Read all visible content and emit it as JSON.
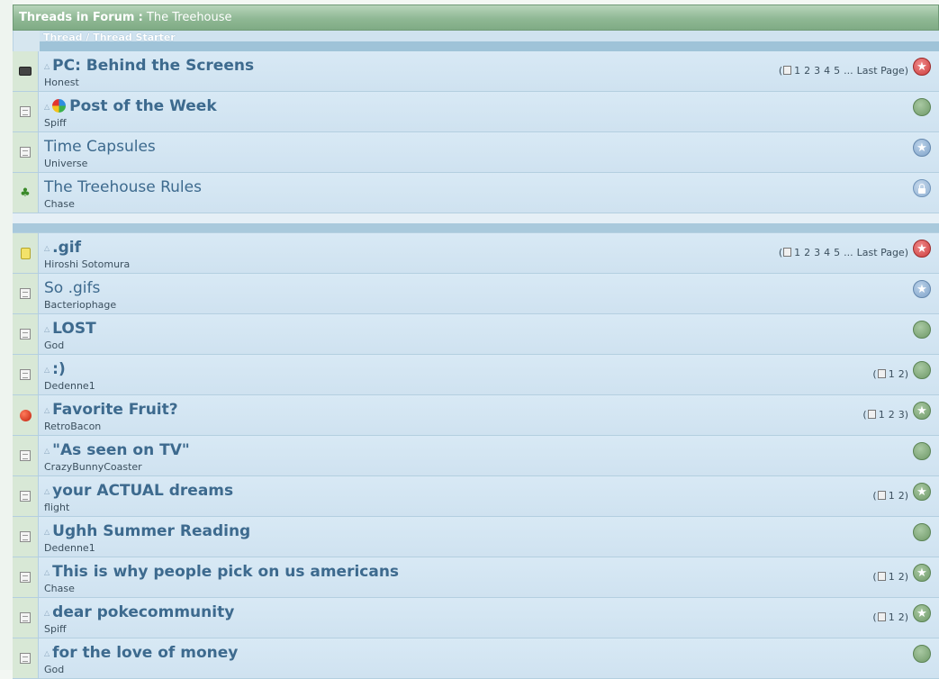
{
  "forum": {
    "header_label": "Threads in Forum",
    "header_sep": ":",
    "forum_name": "The Treehouse",
    "column_header": "Thread / Thread Starter"
  },
  "sticky_threads": [
    {
      "title": "PC: Behind the Screens",
      "starter": "Honest",
      "bold": true,
      "caret": true,
      "prefix_icon": "",
      "row_icon": "camera-icon",
      "pages": [
        "1",
        "2",
        "3",
        "4",
        "5",
        "...",
        "Last Page"
      ],
      "status": "hot-star-icon"
    },
    {
      "title": "Post of the Week",
      "starter": "Spiff",
      "bold": true,
      "caret": true,
      "prefix_icon": "pie-chart-icon",
      "row_icon": "document-icon",
      "pages": [],
      "status": "green-dot-icon"
    },
    {
      "title": "Time Capsules",
      "starter": "Universe",
      "bold": false,
      "caret": false,
      "prefix_icon": "",
      "row_icon": "document-icon",
      "pages": [],
      "status": "blue-star-icon"
    },
    {
      "title": "The Treehouse Rules",
      "starter": "Chase",
      "bold": false,
      "caret": false,
      "prefix_icon": "",
      "row_icon": "tree-icon",
      "pages": [],
      "status": "lock-icon"
    }
  ],
  "threads": [
    {
      "title": ".gif",
      "starter": "Hiroshi Sotomura",
      "bold": true,
      "caret": true,
      "row_icon": "jar-icon",
      "pages": [
        "1",
        "2",
        "3",
        "4",
        "5",
        "...",
        "Last Page"
      ],
      "status": "hot-star-icon"
    },
    {
      "title": "So .gifs",
      "starter": "Bacteriophage",
      "bold": false,
      "caret": false,
      "row_icon": "document-icon",
      "pages": [],
      "status": "blue-star-icon"
    },
    {
      "title": "LOST",
      "starter": "God",
      "bold": true,
      "caret": true,
      "row_icon": "document-icon",
      "pages": [],
      "status": "green-dot-icon"
    },
    {
      "title": ":)",
      "starter": "Dedenne1",
      "bold": true,
      "caret": true,
      "row_icon": "document-icon",
      "pages": [
        "1",
        "2"
      ],
      "status": "green-dot-icon"
    },
    {
      "title": "Favorite Fruit?",
      "starter": "RetroBacon",
      "bold": true,
      "caret": true,
      "row_icon": "apple-icon",
      "pages": [
        "1",
        "2",
        "3"
      ],
      "status": "green-star-icon"
    },
    {
      "title": "\"As seen on TV\"",
      "starter": "CrazyBunnyCoaster",
      "bold": true,
      "caret": true,
      "row_icon": "document-icon",
      "pages": [],
      "status": "green-dot-icon"
    },
    {
      "title": "your ACTUAL dreams",
      "starter": "flight",
      "bold": true,
      "caret": true,
      "row_icon": "document-icon",
      "pages": [
        "1",
        "2"
      ],
      "status": "green-star-icon"
    },
    {
      "title": "Ughh Summer Reading",
      "starter": "Dedenne1",
      "bold": true,
      "caret": true,
      "row_icon": "document-icon",
      "pages": [],
      "status": "green-dot-icon"
    },
    {
      "title": "This is why people pick on us americans",
      "starter": "Chase",
      "bold": true,
      "caret": true,
      "row_icon": "document-icon",
      "pages": [
        "1",
        "2"
      ],
      "status": "green-star-icon"
    },
    {
      "title": "dear pokecommunity",
      "starter": "Spiff",
      "bold": true,
      "caret": true,
      "row_icon": "document-icon",
      "pages": [
        "1",
        "2"
      ],
      "status": "green-star-icon"
    },
    {
      "title": "for the love of money",
      "starter": "God",
      "bold": true,
      "caret": true,
      "row_icon": "document-icon",
      "pages": [],
      "status": "green-dot-icon"
    }
  ],
  "colors": {
    "header_green": "#8fb894",
    "title_blue": "#3d6a8e",
    "row_blue": "#d3e5f2"
  }
}
